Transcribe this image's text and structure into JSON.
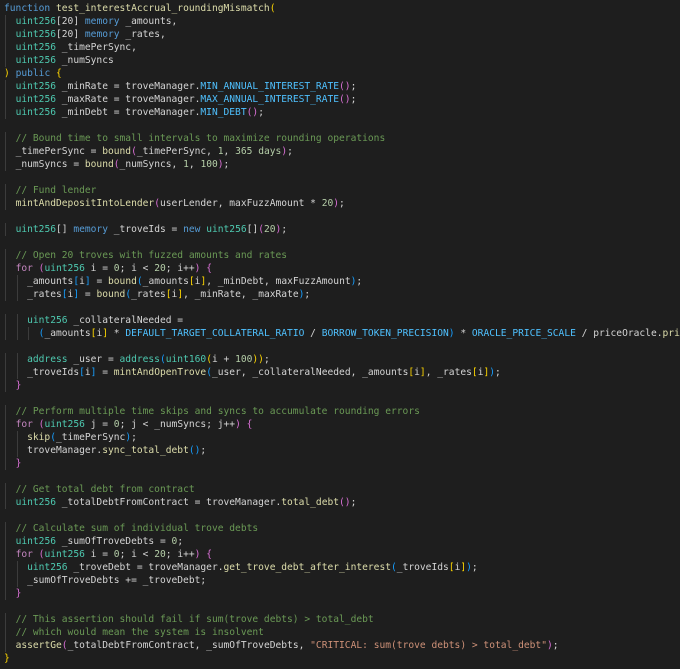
{
  "colors": {
    "background": "#1e1e1e",
    "plain": "#d4d4d4",
    "keyword": "#569cd6",
    "control": "#c586c0",
    "type": "#4ec9b0",
    "function": "#dcdcaa",
    "variable": "#9cdcfe",
    "number": "#b5cea8",
    "string": "#ce9178",
    "comment": "#6a9955",
    "constant": "#4fc1ff",
    "bracket": "#ffd700",
    "bracket2": "#da70d6",
    "bracket3": "#179fff",
    "guide": "#3c3c3c"
  },
  "code": {
    "lines": [
      {
        "indent": 0,
        "tokens": [
          [
            "keyword",
            "function"
          ],
          [
            "plain",
            " "
          ],
          [
            "function",
            "test_interestAccrual_roundingMismatch"
          ],
          [
            "bracket",
            "("
          ]
        ]
      },
      {
        "indent": 2,
        "tokens": [
          [
            "type",
            "uint256"
          ],
          [
            "plain",
            "[20] "
          ],
          [
            "keyword",
            "memory"
          ],
          [
            "plain",
            " _amounts,"
          ]
        ]
      },
      {
        "indent": 2,
        "tokens": [
          [
            "type",
            "uint256"
          ],
          [
            "plain",
            "[20] "
          ],
          [
            "keyword",
            "memory"
          ],
          [
            "plain",
            " _rates,"
          ]
        ]
      },
      {
        "indent": 2,
        "tokens": [
          [
            "type",
            "uint256"
          ],
          [
            "plain",
            " _timePerSync,"
          ]
        ]
      },
      {
        "indent": 2,
        "tokens": [
          [
            "type",
            "uint256"
          ],
          [
            "plain",
            " _numSyncs"
          ]
        ]
      },
      {
        "indent": 0,
        "tokens": [
          [
            "bracket",
            ")"
          ],
          [
            "plain",
            " "
          ],
          [
            "keyword",
            "public"
          ],
          [
            "plain",
            " "
          ],
          [
            "bracket",
            "{"
          ]
        ]
      },
      {
        "indent": 2,
        "tokens": [
          [
            "type",
            "uint256"
          ],
          [
            "plain",
            " _minRate = troveManager."
          ],
          [
            "constant",
            "MIN_ANNUAL_INTEREST_RATE"
          ],
          [
            "bracket2",
            "()"
          ],
          [
            "plain",
            ";"
          ]
        ]
      },
      {
        "indent": 2,
        "tokens": [
          [
            "type",
            "uint256"
          ],
          [
            "plain",
            " _maxRate = troveManager."
          ],
          [
            "constant",
            "MAX_ANNUAL_INTEREST_RATE"
          ],
          [
            "bracket2",
            "()"
          ],
          [
            "plain",
            ";"
          ]
        ]
      },
      {
        "indent": 2,
        "tokens": [
          [
            "type",
            "uint256"
          ],
          [
            "plain",
            " _minDebt = troveManager."
          ],
          [
            "constant",
            "MIN_DEBT"
          ],
          [
            "bracket2",
            "()"
          ],
          [
            "plain",
            ";"
          ]
        ]
      },
      {
        "indent": 0,
        "tokens": []
      },
      {
        "indent": 2,
        "tokens": [
          [
            "comment",
            "// Bound time to small intervals to maximize rounding operations"
          ]
        ]
      },
      {
        "indent": 2,
        "tokens": [
          [
            "plain",
            "_timePerSync = "
          ],
          [
            "function",
            "bound"
          ],
          [
            "bracket2",
            "("
          ],
          [
            "plain",
            "_timePerSync, "
          ],
          [
            "number",
            "1"
          ],
          [
            "plain",
            ", "
          ],
          [
            "number",
            "365 days"
          ],
          [
            "bracket2",
            ")"
          ],
          [
            "plain",
            ";"
          ]
        ]
      },
      {
        "indent": 2,
        "tokens": [
          [
            "plain",
            "_numSyncs = "
          ],
          [
            "function",
            "bound"
          ],
          [
            "bracket2",
            "("
          ],
          [
            "plain",
            "_numSyncs, "
          ],
          [
            "number",
            "1"
          ],
          [
            "plain",
            ", "
          ],
          [
            "number",
            "100"
          ],
          [
            "bracket2",
            ")"
          ],
          [
            "plain",
            ";"
          ]
        ]
      },
      {
        "indent": 0,
        "tokens": []
      },
      {
        "indent": 2,
        "tokens": [
          [
            "comment",
            "// Fund lender"
          ]
        ]
      },
      {
        "indent": 2,
        "tokens": [
          [
            "function",
            "mintAndDepositIntoLender"
          ],
          [
            "bracket2",
            "("
          ],
          [
            "plain",
            "userLender, maxFuzzAmount * "
          ],
          [
            "number",
            "20"
          ],
          [
            "bracket2",
            ")"
          ],
          [
            "plain",
            ";"
          ]
        ]
      },
      {
        "indent": 0,
        "tokens": []
      },
      {
        "indent": 2,
        "tokens": [
          [
            "type",
            "uint256"
          ],
          [
            "plain",
            "[] "
          ],
          [
            "keyword",
            "memory"
          ],
          [
            "plain",
            " _troveIds = "
          ],
          [
            "keyword",
            "new"
          ],
          [
            "plain",
            " "
          ],
          [
            "type",
            "uint256"
          ],
          [
            "plain",
            "[]"
          ],
          [
            "bracket2",
            "("
          ],
          [
            "number",
            "20"
          ],
          [
            "bracket2",
            ")"
          ],
          [
            "plain",
            ";"
          ]
        ]
      },
      {
        "indent": 0,
        "tokens": []
      },
      {
        "indent": 2,
        "tokens": [
          [
            "comment",
            "// Open 20 troves with fuzzed amounts and rates"
          ]
        ]
      },
      {
        "indent": 2,
        "tokens": [
          [
            "control",
            "for"
          ],
          [
            "plain",
            " "
          ],
          [
            "bracket2",
            "("
          ],
          [
            "type",
            "uint256"
          ],
          [
            "plain",
            " i = "
          ],
          [
            "number",
            "0"
          ],
          [
            "plain",
            "; i < "
          ],
          [
            "number",
            "20"
          ],
          [
            "plain",
            "; i++"
          ],
          [
            "bracket2",
            ")"
          ],
          [
            "plain",
            " "
          ],
          [
            "bracket2",
            "{"
          ]
        ]
      },
      {
        "indent": 4,
        "tokens": [
          [
            "plain",
            "_amounts"
          ],
          [
            "bracket3",
            "["
          ],
          [
            "plain",
            "i"
          ],
          [
            "bracket3",
            "]"
          ],
          [
            "plain",
            " = "
          ],
          [
            "function",
            "bound"
          ],
          [
            "bracket3",
            "("
          ],
          [
            "plain",
            "_amounts"
          ],
          [
            "bracket",
            "["
          ],
          [
            "plain",
            "i"
          ],
          [
            "bracket",
            "]"
          ],
          [
            "plain",
            ", _minDebt, maxFuzzAmount"
          ],
          [
            "bracket3",
            ")"
          ],
          [
            "plain",
            ";"
          ]
        ]
      },
      {
        "indent": 4,
        "tokens": [
          [
            "plain",
            "_rates"
          ],
          [
            "bracket3",
            "["
          ],
          [
            "plain",
            "i"
          ],
          [
            "bracket3",
            "]"
          ],
          [
            "plain",
            " = "
          ],
          [
            "function",
            "bound"
          ],
          [
            "bracket3",
            "("
          ],
          [
            "plain",
            "_rates"
          ],
          [
            "bracket",
            "["
          ],
          [
            "plain",
            "i"
          ],
          [
            "bracket",
            "]"
          ],
          [
            "plain",
            ", _minRate, _maxRate"
          ],
          [
            "bracket3",
            ")"
          ],
          [
            "plain",
            ";"
          ]
        ]
      },
      {
        "indent": 0,
        "tokens": []
      },
      {
        "indent": 4,
        "tokens": [
          [
            "type",
            "uint256"
          ],
          [
            "plain",
            " _collateralNeeded ="
          ]
        ]
      },
      {
        "indent": 6,
        "tokens": [
          [
            "bracket3",
            "("
          ],
          [
            "plain",
            "_amounts"
          ],
          [
            "bracket",
            "["
          ],
          [
            "plain",
            "i"
          ],
          [
            "bracket",
            "]"
          ],
          [
            "plain",
            " * "
          ],
          [
            "constant",
            "DEFAULT_TARGET_COLLATERAL_RATIO"
          ],
          [
            "plain",
            " / "
          ],
          [
            "constant",
            "BORROW_TOKEN_PRECISION"
          ],
          [
            "bracket3",
            ")"
          ],
          [
            "plain",
            " * "
          ],
          [
            "constant",
            "ORACLE_PRICE_SCALE"
          ],
          [
            "plain",
            " / priceOracle."
          ],
          [
            "function",
            "price"
          ],
          [
            "bracket3",
            "()"
          ],
          [
            "plain",
            ";"
          ]
        ]
      },
      {
        "indent": 0,
        "tokens": []
      },
      {
        "indent": 4,
        "tokens": [
          [
            "type",
            "address"
          ],
          [
            "plain",
            " _user = "
          ],
          [
            "type",
            "address"
          ],
          [
            "bracket3",
            "("
          ],
          [
            "type",
            "uint160"
          ],
          [
            "bracket",
            "("
          ],
          [
            "plain",
            "i + "
          ],
          [
            "number",
            "100"
          ],
          [
            "bracket",
            "))"
          ],
          [
            "plain",
            ";"
          ]
        ]
      },
      {
        "indent": 4,
        "tokens": [
          [
            "plain",
            "_troveIds"
          ],
          [
            "bracket3",
            "["
          ],
          [
            "plain",
            "i"
          ],
          [
            "bracket3",
            "]"
          ],
          [
            "plain",
            " = "
          ],
          [
            "function",
            "mintAndOpenTrove"
          ],
          [
            "bracket3",
            "("
          ],
          [
            "plain",
            "_user, _collateralNeeded, _amounts"
          ],
          [
            "bracket",
            "["
          ],
          [
            "plain",
            "i"
          ],
          [
            "bracket",
            "]"
          ],
          [
            "plain",
            ", _rates"
          ],
          [
            "bracket",
            "["
          ],
          [
            "plain",
            "i"
          ],
          [
            "bracket",
            "]"
          ],
          [
            "bracket3",
            ")"
          ],
          [
            "plain",
            ";"
          ]
        ]
      },
      {
        "indent": 2,
        "tokens": [
          [
            "bracket2",
            "}"
          ]
        ]
      },
      {
        "indent": 0,
        "tokens": []
      },
      {
        "indent": 2,
        "tokens": [
          [
            "comment",
            "// Perform multiple time skips and syncs to accumulate rounding errors"
          ]
        ]
      },
      {
        "indent": 2,
        "tokens": [
          [
            "control",
            "for"
          ],
          [
            "plain",
            " "
          ],
          [
            "bracket2",
            "("
          ],
          [
            "type",
            "uint256"
          ],
          [
            "plain",
            " j = "
          ],
          [
            "number",
            "0"
          ],
          [
            "plain",
            "; j < _numSyncs; j++"
          ],
          [
            "bracket2",
            ")"
          ],
          [
            "plain",
            " "
          ],
          [
            "bracket2",
            "{"
          ]
        ]
      },
      {
        "indent": 4,
        "tokens": [
          [
            "function",
            "skip"
          ],
          [
            "bracket3",
            "("
          ],
          [
            "plain",
            "_timePerSync"
          ],
          [
            "bracket3",
            ")"
          ],
          [
            "plain",
            ";"
          ]
        ]
      },
      {
        "indent": 4,
        "tokens": [
          [
            "plain",
            "troveManager."
          ],
          [
            "function",
            "sync_total_debt"
          ],
          [
            "bracket3",
            "()"
          ],
          [
            "plain",
            ";"
          ]
        ]
      },
      {
        "indent": 2,
        "tokens": [
          [
            "bracket2",
            "}"
          ]
        ]
      },
      {
        "indent": 0,
        "tokens": []
      },
      {
        "indent": 2,
        "tokens": [
          [
            "comment",
            "// Get total debt from contract"
          ]
        ]
      },
      {
        "indent": 2,
        "tokens": [
          [
            "type",
            "uint256"
          ],
          [
            "plain",
            " _totalDebtFromContract = troveManager."
          ],
          [
            "function",
            "total_debt"
          ],
          [
            "bracket2",
            "()"
          ],
          [
            "plain",
            ";"
          ]
        ]
      },
      {
        "indent": 0,
        "tokens": []
      },
      {
        "indent": 2,
        "tokens": [
          [
            "comment",
            "// Calculate sum of individual trove debts"
          ]
        ]
      },
      {
        "indent": 2,
        "tokens": [
          [
            "type",
            "uint256"
          ],
          [
            "plain",
            " _sumOfTroveDebts = "
          ],
          [
            "number",
            "0"
          ],
          [
            "plain",
            ";"
          ]
        ]
      },
      {
        "indent": 2,
        "tokens": [
          [
            "control",
            "for"
          ],
          [
            "plain",
            " "
          ],
          [
            "bracket2",
            "("
          ],
          [
            "type",
            "uint256"
          ],
          [
            "plain",
            " i = "
          ],
          [
            "number",
            "0"
          ],
          [
            "plain",
            "; i < "
          ],
          [
            "number",
            "20"
          ],
          [
            "plain",
            "; i++"
          ],
          [
            "bracket2",
            ")"
          ],
          [
            "plain",
            " "
          ],
          [
            "bracket2",
            "{"
          ]
        ]
      },
      {
        "indent": 4,
        "tokens": [
          [
            "type",
            "uint256"
          ],
          [
            "plain",
            " _troveDebt = troveManager."
          ],
          [
            "function",
            "get_trove_debt_after_interest"
          ],
          [
            "bracket3",
            "("
          ],
          [
            "plain",
            "_troveIds"
          ],
          [
            "bracket",
            "["
          ],
          [
            "plain",
            "i"
          ],
          [
            "bracket",
            "]"
          ],
          [
            "bracket3",
            ")"
          ],
          [
            "plain",
            ";"
          ]
        ]
      },
      {
        "indent": 4,
        "tokens": [
          [
            "plain",
            "_sumOfTroveDebts += _troveDebt;"
          ]
        ]
      },
      {
        "indent": 2,
        "tokens": [
          [
            "bracket2",
            "}"
          ]
        ]
      },
      {
        "indent": 0,
        "tokens": []
      },
      {
        "indent": 2,
        "tokens": [
          [
            "comment",
            "// This assertion should fail if sum(trove debts) > total_debt"
          ]
        ]
      },
      {
        "indent": 2,
        "tokens": [
          [
            "comment",
            "// which would mean the system is insolvent"
          ]
        ]
      },
      {
        "indent": 2,
        "tokens": [
          [
            "function",
            "assertGe"
          ],
          [
            "bracket2",
            "("
          ],
          [
            "plain",
            "_totalDebtFromContract, _sumOfTroveDebts, "
          ],
          [
            "string",
            "\"CRITICAL: sum(trove debts) > total_debt\""
          ],
          [
            "bracket2",
            ")"
          ],
          [
            "plain",
            ";"
          ]
        ]
      },
      {
        "indent": 0,
        "tokens": [
          [
            "bracket",
            "}"
          ]
        ]
      }
    ]
  }
}
